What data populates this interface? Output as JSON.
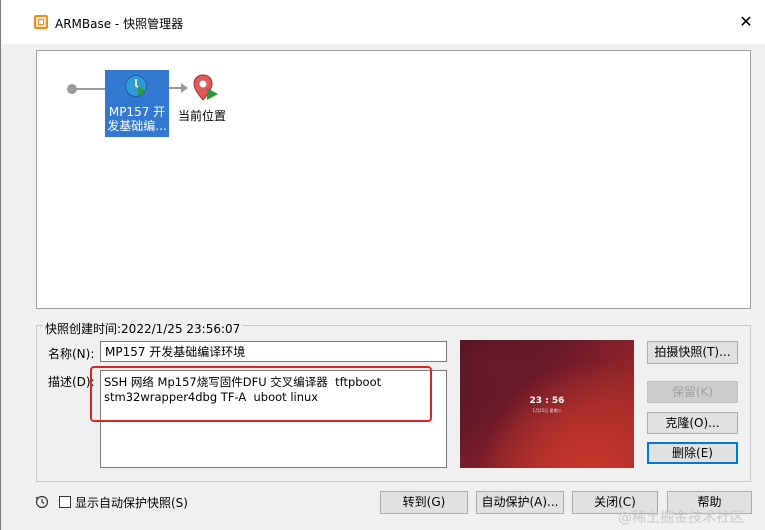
{
  "window": {
    "title": "ARMBase - 快照管理器",
    "close_glyph": "✕"
  },
  "tree": {
    "snapshot_label": "MP157 开发基础编...",
    "current_location_label": "当前位置"
  },
  "details": {
    "created_time_label": "快照创建时间:2022/1/25 23:56:07",
    "name_label": "名称(N):",
    "name_value": "MP157 开发基础编译环境",
    "description_label": "描述(D):",
    "description_value": "SSH 网络 Mp157烧写固件DFU 交叉编译器  tftpboot\nstm32wrapper4dbg TF-A  uboot linux"
  },
  "preview": {
    "time": "23 : 56",
    "date": "1月25日 星期二"
  },
  "side_buttons": {
    "take_snapshot": "拍摄快照(T)...",
    "keep": "保留(K)",
    "clone": "克隆(O)...",
    "delete": "删除(E)"
  },
  "footer": {
    "autoprotect_checkbox_label": "显示自动保护快照(S)",
    "goto": "转到(G)",
    "autoprotect": "自动保护(A)...",
    "close": "关闭(C)",
    "help": "帮助"
  },
  "watermark": "@稀土掘金技术社区",
  "colors": {
    "selection": "#3278d0",
    "highlight_box": "#e02424"
  }
}
